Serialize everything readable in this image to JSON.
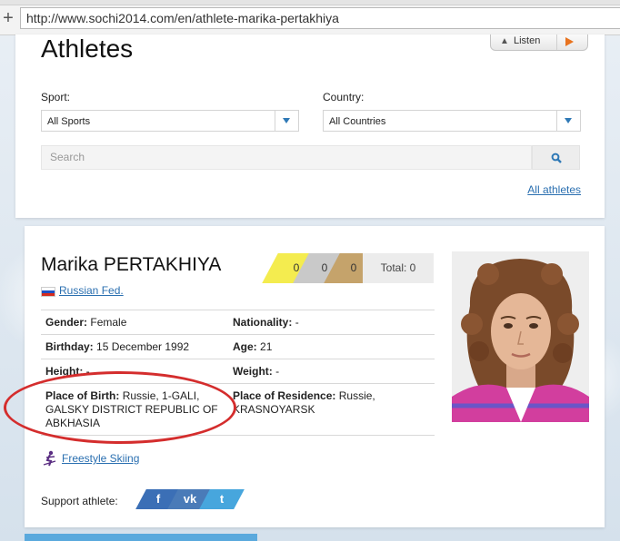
{
  "browser": {
    "url": "http://www.sochi2014.com/en/athlete-marika-pertakhiya"
  },
  "header": {
    "title": "Athletes",
    "listen_label": "Listen"
  },
  "filters": {
    "sport_label": "Sport:",
    "sport_value": "All Sports",
    "country_label": "Country:",
    "country_value": "All Countries",
    "search_placeholder": "Search",
    "all_athletes_link": "All athletes"
  },
  "athlete": {
    "name": "Marika PERTAKHIYA",
    "country": "Russian Fed.",
    "medals": {
      "gold": "0",
      "silver": "0",
      "bronze": "0",
      "total": "Total: 0"
    },
    "info": {
      "gender_label": "Gender:",
      "gender_value": "Female",
      "nationality_label": "Nationality:",
      "nationality_value": "-",
      "birthday_label": "Birthday:",
      "birthday_value": "15 December 1992",
      "age_label": "Age:",
      "age_value": "21",
      "height_label": "Height:",
      "height_value": "-",
      "weight_label": "Weight:",
      "weight_value": "-",
      "birthplace_label": "Place of Birth:",
      "birthplace_value": "Russie, 1-GALI, GALSKY DISTRICT REPUBLIC OF ABKHASIA",
      "residence_label": "Place of Residence:",
      "residence_value": "Russie, KRASNOYARSK"
    },
    "sport": "Freestyle Skiing",
    "support_label": "Support athlete:",
    "social": {
      "facebook": "f",
      "vk": "vk",
      "twitter": "t"
    }
  },
  "colors": {
    "link": "#2a6fb0",
    "gold": "#f4ec4f",
    "silver": "#c9c9c9",
    "bronze": "#c5a36b",
    "annotation_oval": "#d42d2d"
  }
}
